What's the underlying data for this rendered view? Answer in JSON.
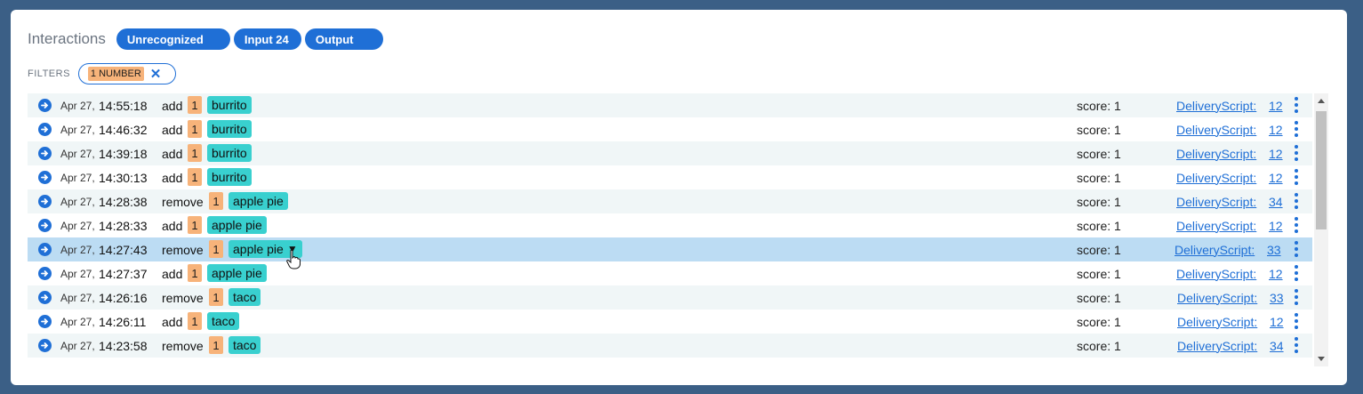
{
  "header": {
    "title": "Interactions",
    "tabs": [
      {
        "label": "Unrecognized"
      },
      {
        "label": "Input 24"
      },
      {
        "label": "Output"
      }
    ]
  },
  "filters": {
    "label": "FILTERS",
    "chip": {
      "badge": "1 NUMBER",
      "remove_icon": "close-icon"
    }
  },
  "rows": [
    {
      "date": "Apr 27,",
      "time": "14:55:18",
      "intent": "add",
      "number": "1",
      "entity": "burrito",
      "score": "score: 1",
      "script": "DeliveryScript:",
      "count": "12"
    },
    {
      "date": "Apr 27,",
      "time": "14:46:32",
      "intent": "add",
      "number": "1",
      "entity": "burrito",
      "score": "score: 1",
      "script": "DeliveryScript:",
      "count": "12"
    },
    {
      "date": "Apr 27,",
      "time": "14:39:18",
      "intent": "add",
      "number": "1",
      "entity": "burrito",
      "score": "score: 1",
      "script": "DeliveryScript:",
      "count": "12"
    },
    {
      "date": "Apr 27,",
      "time": "14:30:13",
      "intent": "add",
      "number": "1",
      "entity": "burrito",
      "score": "score: 1",
      "script": "DeliveryScript:",
      "count": "12"
    },
    {
      "date": "Apr 27,",
      "time": "14:28:38",
      "intent": "remove",
      "number": "1",
      "entity": "apple pie",
      "score": "score: 1",
      "script": "DeliveryScript:",
      "count": "34"
    },
    {
      "date": "Apr 27,",
      "time": "14:28:33",
      "intent": "add",
      "number": "1",
      "entity": "apple pie",
      "score": "score: 1",
      "script": "DeliveryScript:",
      "count": "12"
    },
    {
      "date": "Apr 27,",
      "time": "14:27:43",
      "intent": "remove",
      "number": "1",
      "entity": "apple pie",
      "score": "score: 1",
      "script": "DeliveryScript:",
      "count": "33",
      "selected": true
    },
    {
      "date": "Apr 27,",
      "time": "14:27:37",
      "intent": "add",
      "number": "1",
      "entity": "apple pie",
      "score": "score: 1",
      "script": "DeliveryScript:",
      "count": "12"
    },
    {
      "date": "Apr 27,",
      "time": "14:26:16",
      "intent": "remove",
      "number": "1",
      "entity": "taco",
      "score": "score: 1",
      "script": "DeliveryScript:",
      "count": "33"
    },
    {
      "date": "Apr 27,",
      "time": "14:26:11",
      "intent": "add",
      "number": "1",
      "entity": "taco",
      "score": "score: 1",
      "script": "DeliveryScript:",
      "count": "12"
    },
    {
      "date": "Apr 27,",
      "time": "14:23:58",
      "intent": "remove",
      "number": "1",
      "entity": "taco",
      "score": "score: 1",
      "script": "DeliveryScript:",
      "count": "34"
    }
  ],
  "colors": {
    "accent": "#1f6fd6",
    "number_badge": "#f7b37a",
    "entity_badge": "#39d0cf",
    "selected_row": "#bcdcf3",
    "background": "#3b5f86"
  }
}
